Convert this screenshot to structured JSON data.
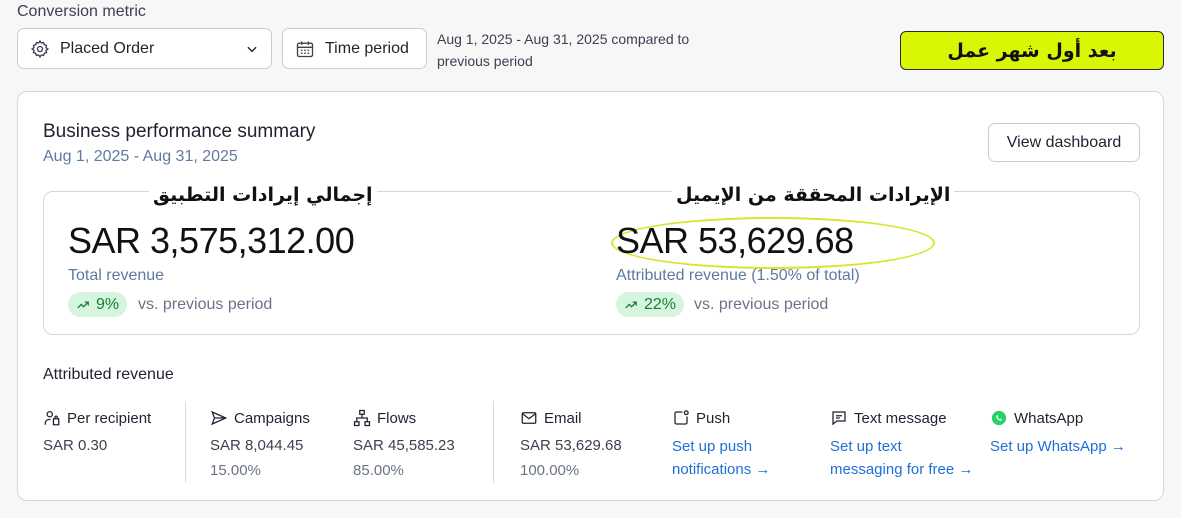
{
  "header": {
    "metric_label": "Conversion metric",
    "metric_select_value": "Placed Order",
    "time_button_label": "Time period",
    "range_line1": "Aug 1, 2025 - Aug 31, 2025 compared to",
    "range_line2": "previous period",
    "arabic_badge": "بعد أول شهر عمل"
  },
  "card": {
    "title": "Business performance summary",
    "date": "Aug 1, 2025 - Aug 31, 2025",
    "view_button": "View dashboard"
  },
  "total": {
    "arabic_label": "إجمالي إيرادات التطبيق",
    "value": "SAR 3,575,312.00",
    "label": "Total revenue",
    "change": "9%",
    "vs": "vs. previous period"
  },
  "attributed": {
    "arabic_label": "الإيرادات المحققة من الإيميل",
    "value": "SAR 53,629.68",
    "label": "Attributed revenue (1.50% of total)",
    "change": "22%",
    "vs": "vs. previous period"
  },
  "breakdown": {
    "title": "Attributed revenue",
    "per_recipient": {
      "label": "Per recipient",
      "value": "SAR 0.30"
    },
    "campaigns": {
      "label": "Campaigns",
      "value": "SAR 8,044.45",
      "pct": "15.00%"
    },
    "flows": {
      "label": "Flows",
      "value": "SAR 45,585.23",
      "pct": "85.00%"
    },
    "email": {
      "label": "Email",
      "value": "SAR 53,629.68",
      "pct": "100.00%"
    },
    "push": {
      "label": "Push",
      "link1": "Set up push",
      "link2": "notifications →"
    },
    "sms": {
      "label": "Text message",
      "link1": "Set up text",
      "link2": "messaging for free →"
    },
    "whatsapp": {
      "label": "WhatsApp",
      "link1": "Set up WhatsApp →"
    }
  },
  "colors": {
    "accent_link": "#1f6fd6",
    "positive_pill_bg": "#d6f5df",
    "positive_text": "#1b7a3a",
    "highlight_badge": "#d9f705"
  }
}
